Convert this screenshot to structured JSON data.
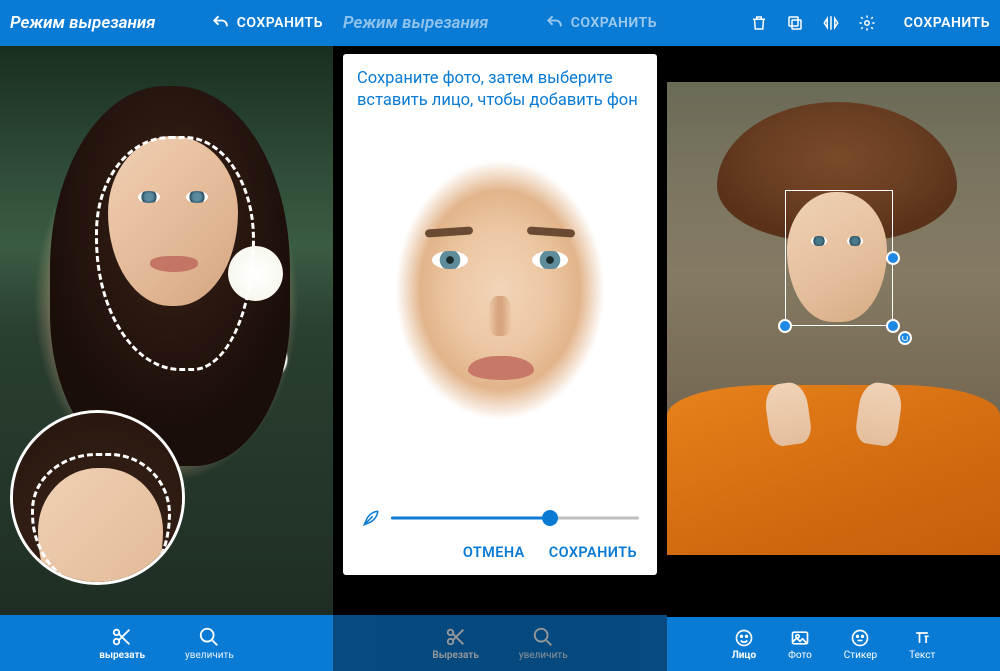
{
  "screen1": {
    "title": "Режим вырезания",
    "save": "СОХРАНИТЬ",
    "undo_icon": "undo-icon",
    "tools": {
      "cut": "вырезать",
      "zoom": "увеличить"
    }
  },
  "screen2": {
    "title": "Режим вырезания",
    "save": "СОХРАНИТЬ",
    "dialog": {
      "message": "Сохраните фото, затем выберите вставить лицо, чтобы добавить фон",
      "cancel": "ОТМЕНА",
      "confirm": "СОХРАНИТЬ",
      "slider_value": 64
    },
    "tools": {
      "cut": "Вырезать",
      "zoom": "увеличить"
    }
  },
  "screen3": {
    "save": "СОХРАНИТЬ",
    "icons": [
      "delete",
      "copy",
      "flip",
      "settings"
    ],
    "tabs": {
      "face": "Лицо",
      "photo": "Фото",
      "sticker": "Стикер",
      "text": "Текст"
    },
    "active_tab": "face"
  }
}
